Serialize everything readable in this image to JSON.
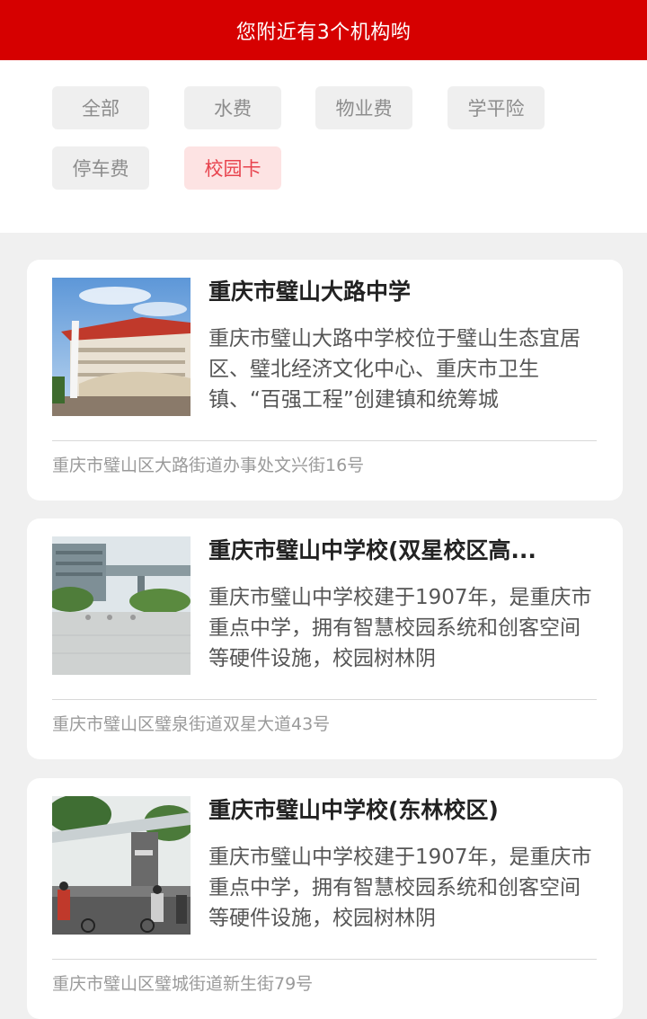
{
  "header": {
    "title": "您附近有3个机构哟"
  },
  "filters": [
    {
      "label": "全部",
      "active": false
    },
    {
      "label": "水费",
      "active": false
    },
    {
      "label": "物业费",
      "active": false
    },
    {
      "label": "学平险",
      "active": false
    },
    {
      "label": "停车费",
      "active": false
    },
    {
      "label": "校园卡",
      "active": true
    }
  ],
  "institutions": [
    {
      "name": "重庆市璧山大路中学",
      "description": "重庆市璧山大路中学校位于璧山生态宜居区、璧北经济文化中心、重庆市卫生镇、“百强工程”创建镇和统筹城",
      "address": "重庆市璧山区大路街道办事处文兴街16号",
      "image_icon": "school-building-photo"
    },
    {
      "name": "重庆市璧山中学校(双星校区高...",
      "description": "重庆市璧山中学校建于1907年，是重庆市重点中学，拥有智慧校园系统和创客空间等硬件设施，校园树林阴",
      "address": "重庆市璧山区璧泉街道双星大道43号",
      "image_icon": "campus-plaza-photo"
    },
    {
      "name": "重庆市璧山中学校(东林校区)",
      "description": "重庆市璧山中学校建于1907年，是重庆市重点中学，拥有智慧校园系统和创客空间等硬件设施，校园树林阴",
      "address": "重庆市璧山区璧城街道新生街79号",
      "image_icon": "school-gate-photo"
    }
  ],
  "colors": {
    "brand_red": "#d60000",
    "active_chip_bg": "#fde3e3",
    "active_chip_text": "#e8434e"
  }
}
